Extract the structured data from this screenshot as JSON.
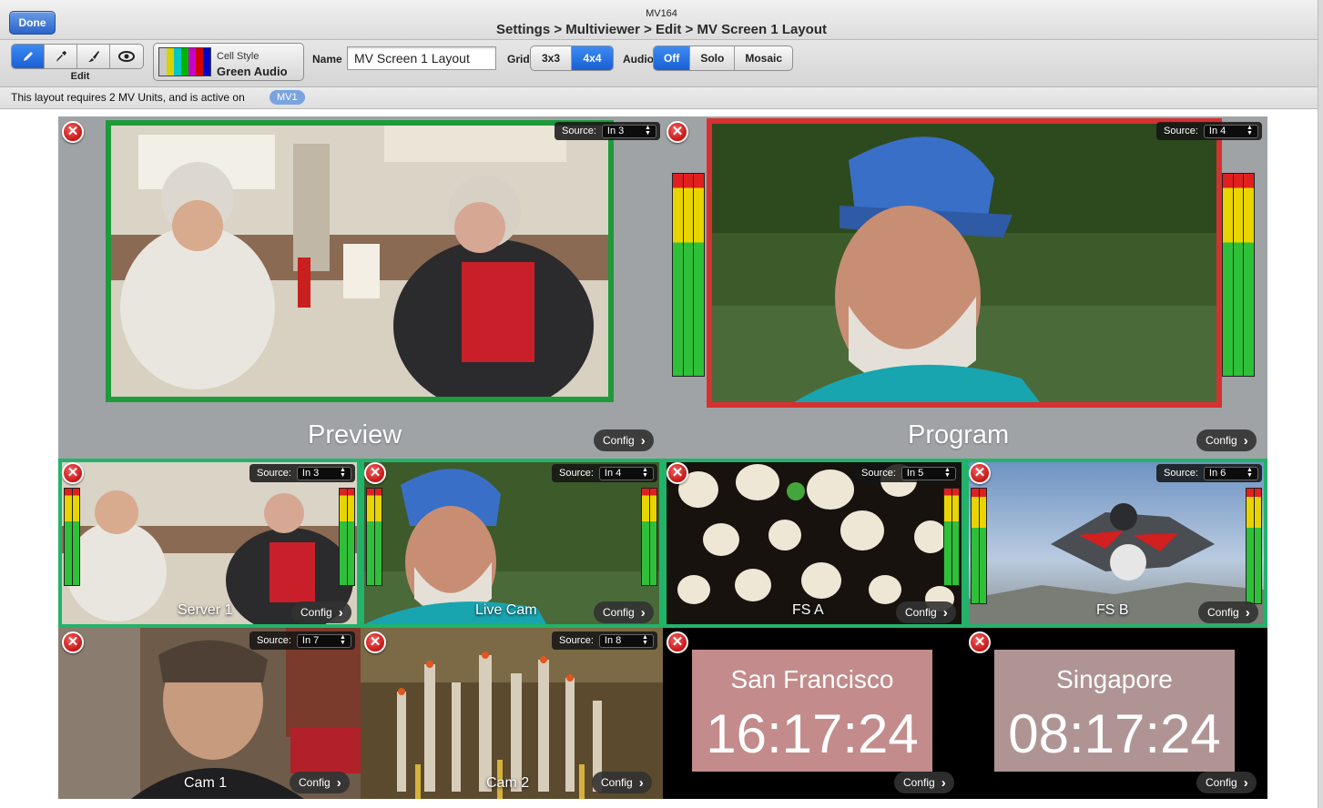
{
  "header": {
    "done_label": "Done",
    "device_name": "MV164",
    "breadcrumb": "Settings > Multiviewer > Edit > MV Screen 1 Layout"
  },
  "toolbar": {
    "edit_tools": [
      {
        "name": "pencil-icon",
        "glyph": "✎",
        "active": true
      },
      {
        "name": "eyedropper-icon",
        "glyph": "✒",
        "active": false
      },
      {
        "name": "paint-brush-icon",
        "glyph": "✐",
        "active": false
      },
      {
        "name": "eye-icon",
        "glyph": "◉",
        "active": false
      }
    ],
    "edit_label": "Edit",
    "cell_style_label": "Cell Style",
    "cell_style_value": "Green Audio",
    "name_label": "Name",
    "name_value": "MV Screen 1 Layout",
    "grid_label": "Grid",
    "grid_options": [
      "3x3",
      "4x4"
    ],
    "grid_selected": "4x4",
    "audio_label": "Audio",
    "audio_options": [
      "Off",
      "Solo",
      "Mosaic"
    ],
    "audio_selected": "Off"
  },
  "info": {
    "text": "This layout requires 2 MV Units, and is active on",
    "badge": "MV1"
  },
  "labels": {
    "source": "Source:",
    "config": "Config",
    "close_glyph": "✕"
  },
  "cells": {
    "preview": {
      "label": "Preview",
      "source": "In 3",
      "border_color": "#1e9a3b"
    },
    "program": {
      "label": "Program",
      "source": "In 4",
      "border_color": "#d53131"
    },
    "server1": {
      "label": "Server 1",
      "source": "In 3"
    },
    "livecam": {
      "label": "Live Cam",
      "source": "In 4"
    },
    "fsa": {
      "label": "FS A",
      "source": "In 5"
    },
    "fsb": {
      "label": "FS B",
      "source": "In 6"
    },
    "cam1": {
      "label": "Cam 1",
      "source": "In 7"
    },
    "cam2": {
      "label": "Cam 2",
      "source": "In 8"
    },
    "clock_sf": {
      "city": "San Francisco",
      "time": "16:17:24"
    },
    "clock_sg": {
      "city": "Singapore",
      "time": "08:17:24"
    }
  },
  "colors": {
    "tally_green": "#22b36a",
    "accent_blue": "#1a5fd3",
    "clock_bg": "#c38b8b"
  }
}
